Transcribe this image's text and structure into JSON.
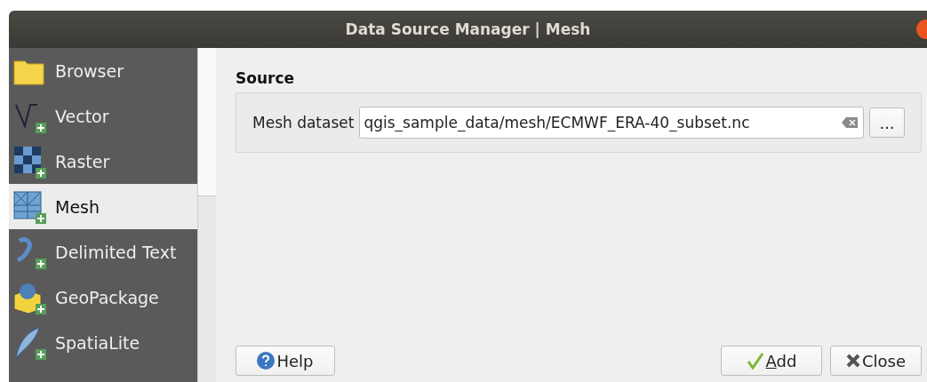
{
  "window": {
    "title": "Data Source Manager | Mesh"
  },
  "sidebar": {
    "items": [
      {
        "kind": "folder",
        "label": "Browser",
        "selected": false
      },
      {
        "kind": "vector",
        "label": "Vector",
        "selected": false
      },
      {
        "kind": "raster",
        "label": "Raster",
        "selected": false
      },
      {
        "kind": "mesh",
        "label": "Mesh",
        "selected": true
      },
      {
        "kind": "text",
        "label": "Delimited Text",
        "selected": false
      },
      {
        "kind": "geopackage",
        "label": "GeoPackage",
        "selected": false
      },
      {
        "kind": "spatialite",
        "label": "SpatiaLite",
        "selected": false
      }
    ]
  },
  "source": {
    "title": "Source",
    "label": "Mesh dataset",
    "value": "qgis_sample_data/mesh/ECMWF_ERA-40_subset.nc",
    "browse": "..."
  },
  "buttons": {
    "help": "Help",
    "add": "Add",
    "close": "Close"
  }
}
